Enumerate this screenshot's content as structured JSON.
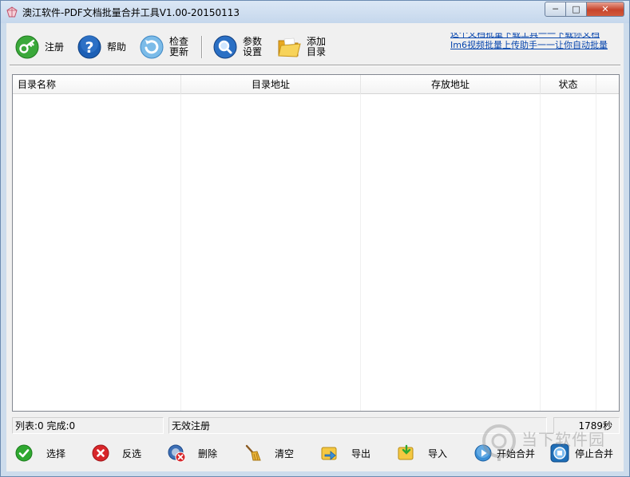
{
  "window": {
    "title": "澳江软件-PDF文档批量合并工具V1.00-20150113",
    "min_symbol": "─",
    "max_symbol": "□",
    "close_symbol": "✕"
  },
  "toolbar": {
    "register": "注册",
    "help": "帮助",
    "check_update": "检查更新",
    "settings": "参数设置",
    "add_dir": "添加目录",
    "ad_line1": "这个文档批量下载工具一一下载你文档",
    "ad_line2": "Im6视频批量上传助手一一让你自动批量"
  },
  "table": {
    "headers": [
      "目录名称",
      "目录地址",
      "存放地址",
      "状态"
    ]
  },
  "status": {
    "counts": "列表:0 完成:0",
    "registration": "无效注册",
    "timer": "1789秒"
  },
  "actions": {
    "select": "选择",
    "invert": "反选",
    "delete": "删除",
    "clear": "清空",
    "export": "导出",
    "import": "导入",
    "start": "开始合并",
    "stop": "停止合并"
  },
  "watermark": {
    "text": "当下软件园"
  },
  "colors": {
    "accent_blue": "#1c5fb5",
    "link_blue": "#0645ad",
    "green": "#2fa830",
    "red": "#d8262a",
    "folder_yellow": "#f2c233"
  }
}
